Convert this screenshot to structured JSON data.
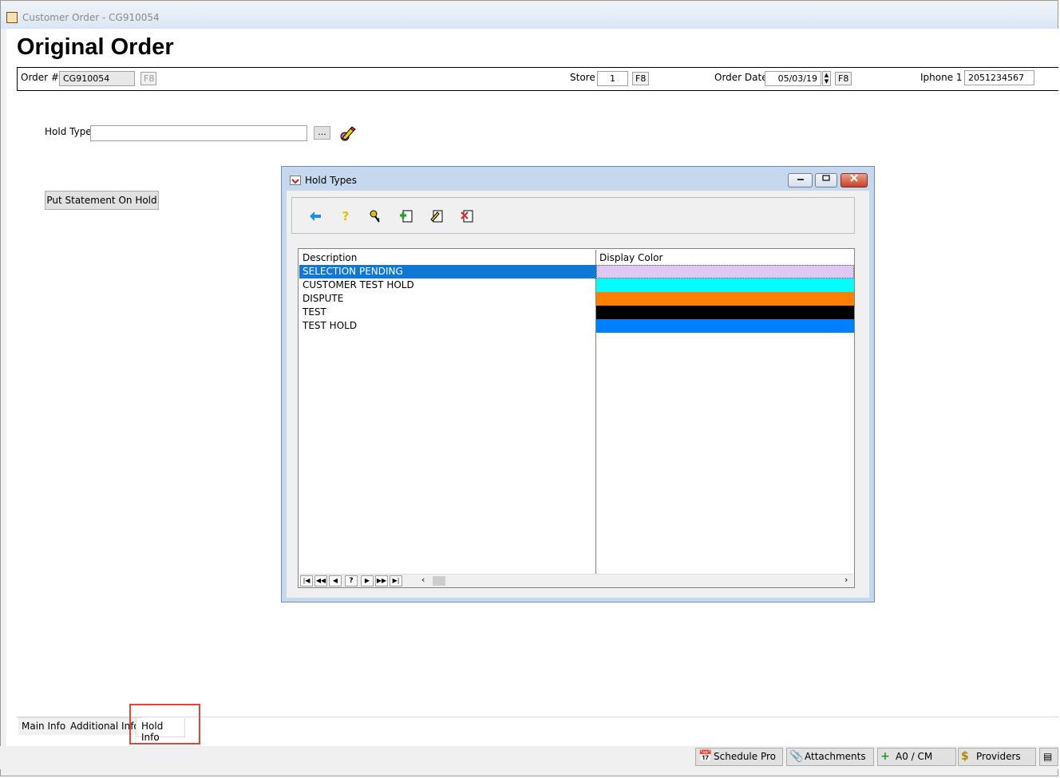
{
  "window": {
    "title": "Customer Order - CG910054"
  },
  "page": {
    "heading": "Original Order"
  },
  "header": {
    "order_label": "Order #",
    "order_value": "CG910054",
    "order_key": "F8",
    "store_label": "Store",
    "store_value": "1",
    "store_key": "F8",
    "order_date_label": "Order Date",
    "order_date_value": "05/03/19",
    "order_date_key": "F8",
    "phone_label": "Iphone 1",
    "phone_value": "2051234567"
  },
  "hold": {
    "hold_type_label": "Hold Type",
    "hold_type_value": "",
    "browse_label": "...",
    "put_on_hold_label": "Put Statement On Hold"
  },
  "dialog": {
    "title": "Hold Types",
    "columns": [
      "Description",
      "Display Color"
    ],
    "rows": [
      {
        "description": "SELECTION PENDING",
        "color": "#e0c8f5",
        "selected": true
      },
      {
        "description": "CUSTOMER TEST HOLD",
        "color": "#00ffff",
        "selected": false
      },
      {
        "description": "DISPUTE",
        "color": "#ff8000",
        "selected": false
      },
      {
        "description": "TEST",
        "color": "#000000",
        "selected": false
      },
      {
        "description": "TEST HOLD",
        "color": "#0080ff",
        "selected": false
      }
    ],
    "toolbar": [
      "back-arrow-icon",
      "help-icon",
      "key-icon",
      "add-record-icon",
      "edit-record-icon",
      "delete-record-icon"
    ],
    "nav_help": "?"
  },
  "tabs": [
    "Main Info",
    "Additional Info",
    "Hold Info"
  ],
  "footer": {
    "schedule_label": "Schedule Pro",
    "attachments_label": "Attachments",
    "ao_cm_label": "A0 / CM",
    "providers_label": "Providers"
  },
  "colors": {
    "selection": "#0f78d7",
    "highlight_box": "#e0443c"
  }
}
